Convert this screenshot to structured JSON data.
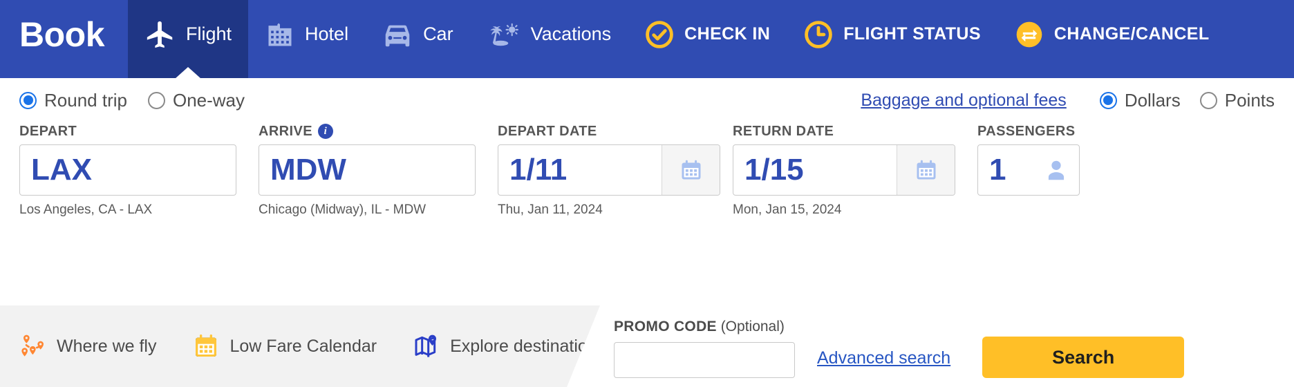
{
  "nav": {
    "brand": "Book",
    "items": [
      {
        "label": "Flight",
        "icon": "airplane-icon",
        "active": true,
        "emphasis": "normal"
      },
      {
        "label": "Hotel",
        "icon": "hotel-building-icon",
        "active": false,
        "emphasis": "normal"
      },
      {
        "label": "Car",
        "icon": "car-icon",
        "active": false,
        "emphasis": "normal"
      },
      {
        "label": "Vacations",
        "icon": "palm-tree-sun-icon",
        "active": false,
        "emphasis": "normal"
      },
      {
        "label": "CHECK IN",
        "icon": "check-circle-icon",
        "active": false,
        "emphasis": "strong"
      },
      {
        "label": "FLIGHT STATUS",
        "icon": "clock-icon",
        "active": false,
        "emphasis": "strong"
      },
      {
        "label": "CHANGE/CANCEL",
        "icon": "swap-arrows-icon",
        "active": false,
        "emphasis": "strong"
      }
    ]
  },
  "trip_type": {
    "options": [
      {
        "label": "Round trip",
        "selected": true
      },
      {
        "label": "One-way",
        "selected": false
      }
    ]
  },
  "baggage_link": "Baggage and optional fees",
  "currency": {
    "options": [
      {
        "label": "Dollars",
        "selected": true
      },
      {
        "label": "Points",
        "selected": false
      }
    ]
  },
  "fields": {
    "depart": {
      "label": "DEPART",
      "value": "LAX",
      "hint": "Los Angeles, CA - LAX"
    },
    "arrive": {
      "label": "ARRIVE",
      "info_icon": "info-icon",
      "value": "MDW",
      "hint": "Chicago (Midway), IL - MDW"
    },
    "depart_date": {
      "label": "DEPART DATE",
      "value": "1/11",
      "hint": "Thu, Jan 11, 2024",
      "icon": "calendar-icon"
    },
    "return_date": {
      "label": "RETURN DATE",
      "value": "1/15",
      "hint": "Mon, Jan 15, 2024",
      "icon": "calendar-icon"
    },
    "passengers": {
      "label": "PASSENGERS",
      "value": "1",
      "icon": "person-icon"
    }
  },
  "promo": {
    "label_main": "PROMO CODE",
    "label_optional": "(Optional)",
    "value": "",
    "placeholder": ""
  },
  "advanced_search": "Advanced search",
  "search_button": "Search",
  "bottom_links": [
    {
      "label": "Where we fly",
      "icon": "route-pins-icon"
    },
    {
      "label": "Low Fare Calendar",
      "icon": "calendar-icon"
    },
    {
      "label": "Explore destinations",
      "icon": "map-pin-icon"
    }
  ],
  "colors": {
    "nav_blue": "#304CB2",
    "nav_active_blue": "#1F3685",
    "accent_yellow": "#FFBF27",
    "link_blue": "#2756C3",
    "radio_blue": "#1A73E8",
    "icon_lavender": "#A7B8E8",
    "orange": "#FF8733"
  }
}
